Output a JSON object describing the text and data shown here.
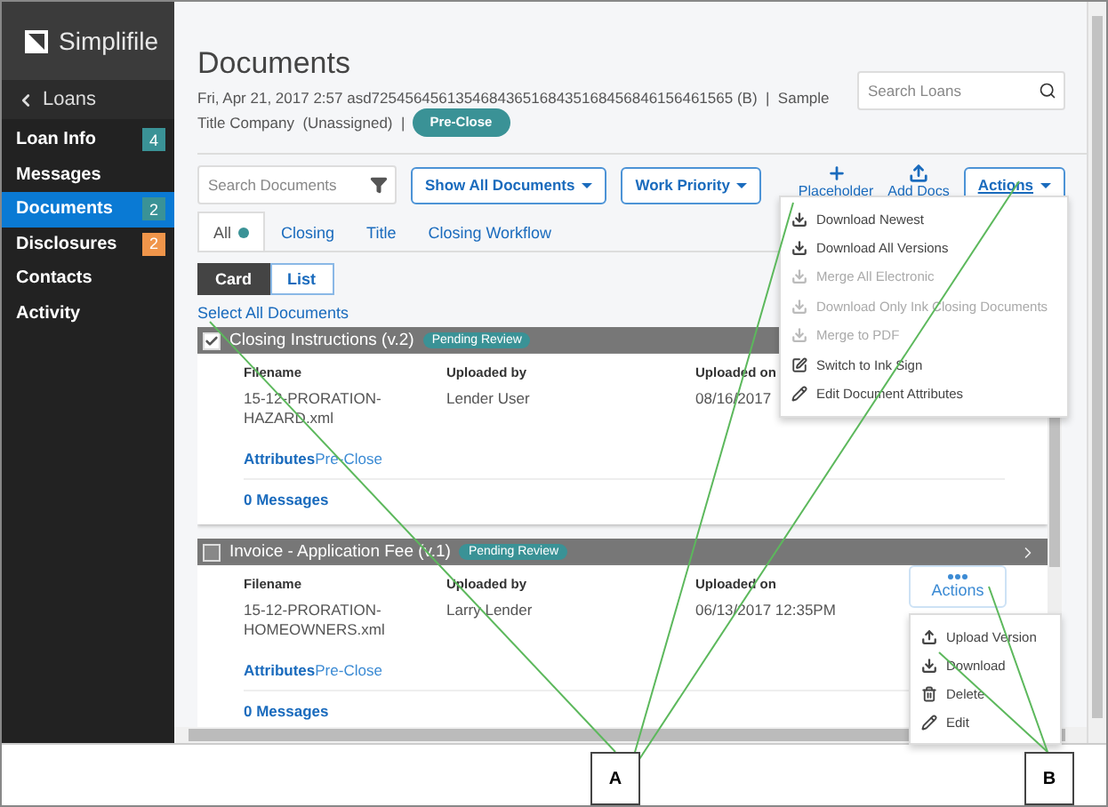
{
  "sidebar": {
    "logo": "Simplifile",
    "back": "Loans",
    "items": [
      {
        "label": "Loan Info",
        "badge": "4",
        "color": "#3a9296",
        "selected": false
      },
      {
        "label": "Messages",
        "selected": false
      },
      {
        "label": "Documents",
        "badge": "2",
        "color": "#3a9296",
        "selected": true
      },
      {
        "label": "Disclosures",
        "badge": "2",
        "color": "#f0954a",
        "selected": false
      },
      {
        "label": "Contacts",
        "selected": false
      },
      {
        "label": "Activity",
        "selected": false
      }
    ]
  },
  "header": {
    "title": "Documents",
    "subtitle": [
      "Fri, Apr 21, 2017 2:57 asd7254564561354684365168435168456846156461565 (B)  |  Sample",
      "Title Company  (Unassigned)  |"
    ],
    "status": "Pre-Close",
    "search": {
      "placeholder": "Search Loans"
    }
  },
  "toolbar": {
    "search": {
      "placeholder": "Search Documents"
    },
    "dropdowns": [
      "Show All Documents",
      "Work Priority"
    ],
    "placeholder_button": "Placeholder",
    "add_button": "Add Docs",
    "actions": "Actions"
  },
  "tabs": [
    {
      "label": "All",
      "selected": true,
      "dot": true
    },
    {
      "label": "Closing",
      "selected": false
    },
    {
      "label": "Title",
      "selected": false
    },
    {
      "label": "Closing Workflow",
      "selected": false
    }
  ],
  "view_toggle": [
    {
      "label": "Card",
      "selected": true
    },
    {
      "label": "List",
      "selected": false
    }
  ],
  "select_all": "Select All Documents",
  "documents": [
    {
      "title": "Closing Instructions (v.2)",
      "status": "Pending Review",
      "checked": true,
      "filename_label": "Filename",
      "filename": "15-12-PRORATION-HAZARD.xml",
      "uploaded_by_label": "Uploaded by",
      "uploaded_by": "Lender User",
      "uploaded_on_label": "Uploaded on",
      "uploaded_on": "08/16/2017",
      "attributes_label": "Attributes",
      "attributes": "Pre-Close",
      "messages": "0 Messages"
    },
    {
      "title": "Invoice - Application Fee (v.1)",
      "status": "Pending Review",
      "checked": false,
      "filename_label": "Filename",
      "filename": "15-12-PRORATION-HOMEOWNERS.xml",
      "uploaded_by_label": "Uploaded by",
      "uploaded_by": "Larry Lender",
      "uploaded_on_label": "Uploaded on",
      "uploaded_on": "06/13/2017 12:35PM",
      "attributes_label": "Attributes",
      "attributes": "Pre-Close",
      "messages": "0 Messages",
      "actions": "Actions",
      "chevron": true
    }
  ],
  "actions_menu": [
    {
      "label": "Download Newest",
      "kind": "download",
      "disabled": false
    },
    {
      "label": "Download All Versions",
      "kind": "download",
      "disabled": false
    },
    {
      "label": "Merge All Electronic",
      "kind": "download",
      "disabled": true
    },
    {
      "label": "Download Only Ink Closing Documents",
      "kind": "download",
      "disabled": true
    },
    {
      "label": "Merge to PDF",
      "kind": "download",
      "disabled": true
    },
    {
      "label": "Switch to Ink Sign",
      "kind": "sign",
      "disabled": false
    },
    {
      "label": "Edit Document Attributes",
      "kind": "edit",
      "disabled": false
    }
  ],
  "document_menu": [
    {
      "label": "Upload Version",
      "kind": "upload"
    },
    {
      "label": "Download",
      "kind": "download"
    },
    {
      "label": "Delete",
      "kind": "delete"
    },
    {
      "label": "Edit",
      "kind": "edit"
    }
  ],
  "callouts": [
    "A",
    "B"
  ]
}
